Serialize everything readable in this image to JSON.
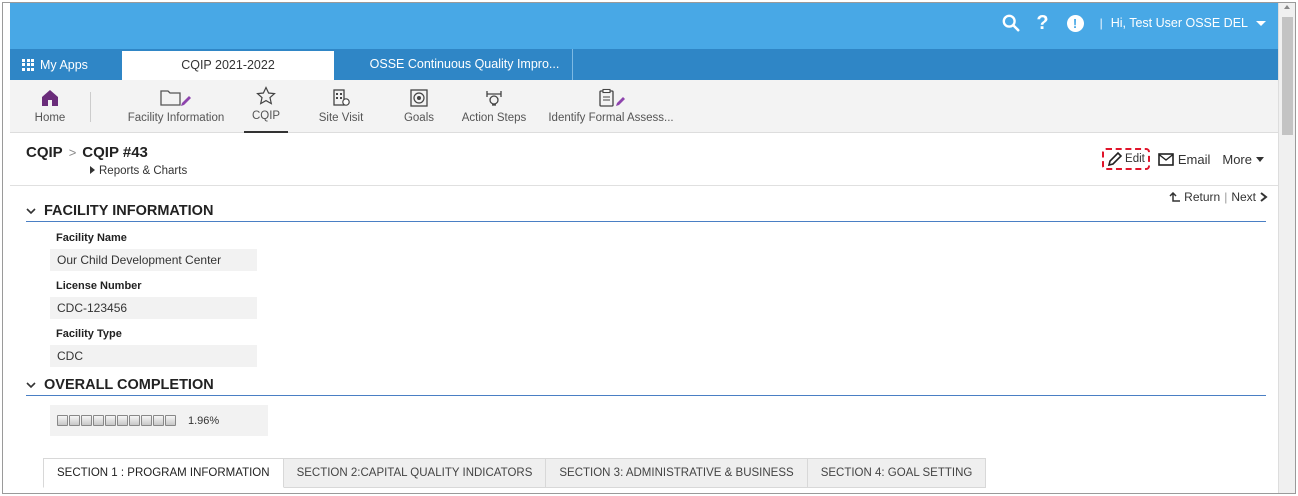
{
  "topbar": {
    "user": "Hi, Test User OSSE DEL",
    "separator": "|",
    "help": "?",
    "alert": "!"
  },
  "tabs": {
    "my_apps": "My Apps",
    "active": "CQIP 2021-2022",
    "other": "OSSE Continuous Quality Impro..."
  },
  "nav": {
    "items": [
      {
        "label": "Home",
        "icon": "home-icon"
      },
      {
        "label": "Facility Information",
        "icon": "folder-edit-icon"
      },
      {
        "label": "CQIP",
        "icon": "star-outline-icon"
      },
      {
        "label": "Site Visit",
        "icon": "building-icon"
      },
      {
        "label": "Goals",
        "icon": "target-icon"
      },
      {
        "label": "Action Steps",
        "icon": "steps-icon"
      },
      {
        "label": "Identify Formal Assess...",
        "icon": "clipboard-edit-icon"
      }
    ]
  },
  "header": {
    "crumb_root": "CQIP",
    "crumb_sep": ">",
    "crumb_current": "CQIP #43",
    "subcrumb": "Reports & Charts",
    "edit": "Edit",
    "email": "Email",
    "more": "More"
  },
  "nav_links": {
    "return": "Return",
    "next": "Next"
  },
  "facility": {
    "title": "FACILITY INFORMATION",
    "name_label": "Facility Name",
    "name_value": "Our Child Development Center",
    "license_label": "License Number",
    "license_value": "CDC-123456",
    "type_label": "Facility Type",
    "type_value": "CDC"
  },
  "completion": {
    "title": "OVERALL COMPLETION",
    "percent_text": "1.96%",
    "segments": 10
  },
  "section_tabs": [
    "SECTION 1 : PROGRAM INFORMATION",
    "SECTION 2:CAPITAL QUALITY INDICATORS",
    "SECTION 3: ADMINISTRATIVE & BUSINESS",
    "SECTION 4: GOAL SETTING"
  ],
  "colors": {
    "topbar": "#48a8e6",
    "tabrow": "#2f86c6",
    "section_rule": "#4a7fc4",
    "edit_highlight": "#e0152b"
  }
}
